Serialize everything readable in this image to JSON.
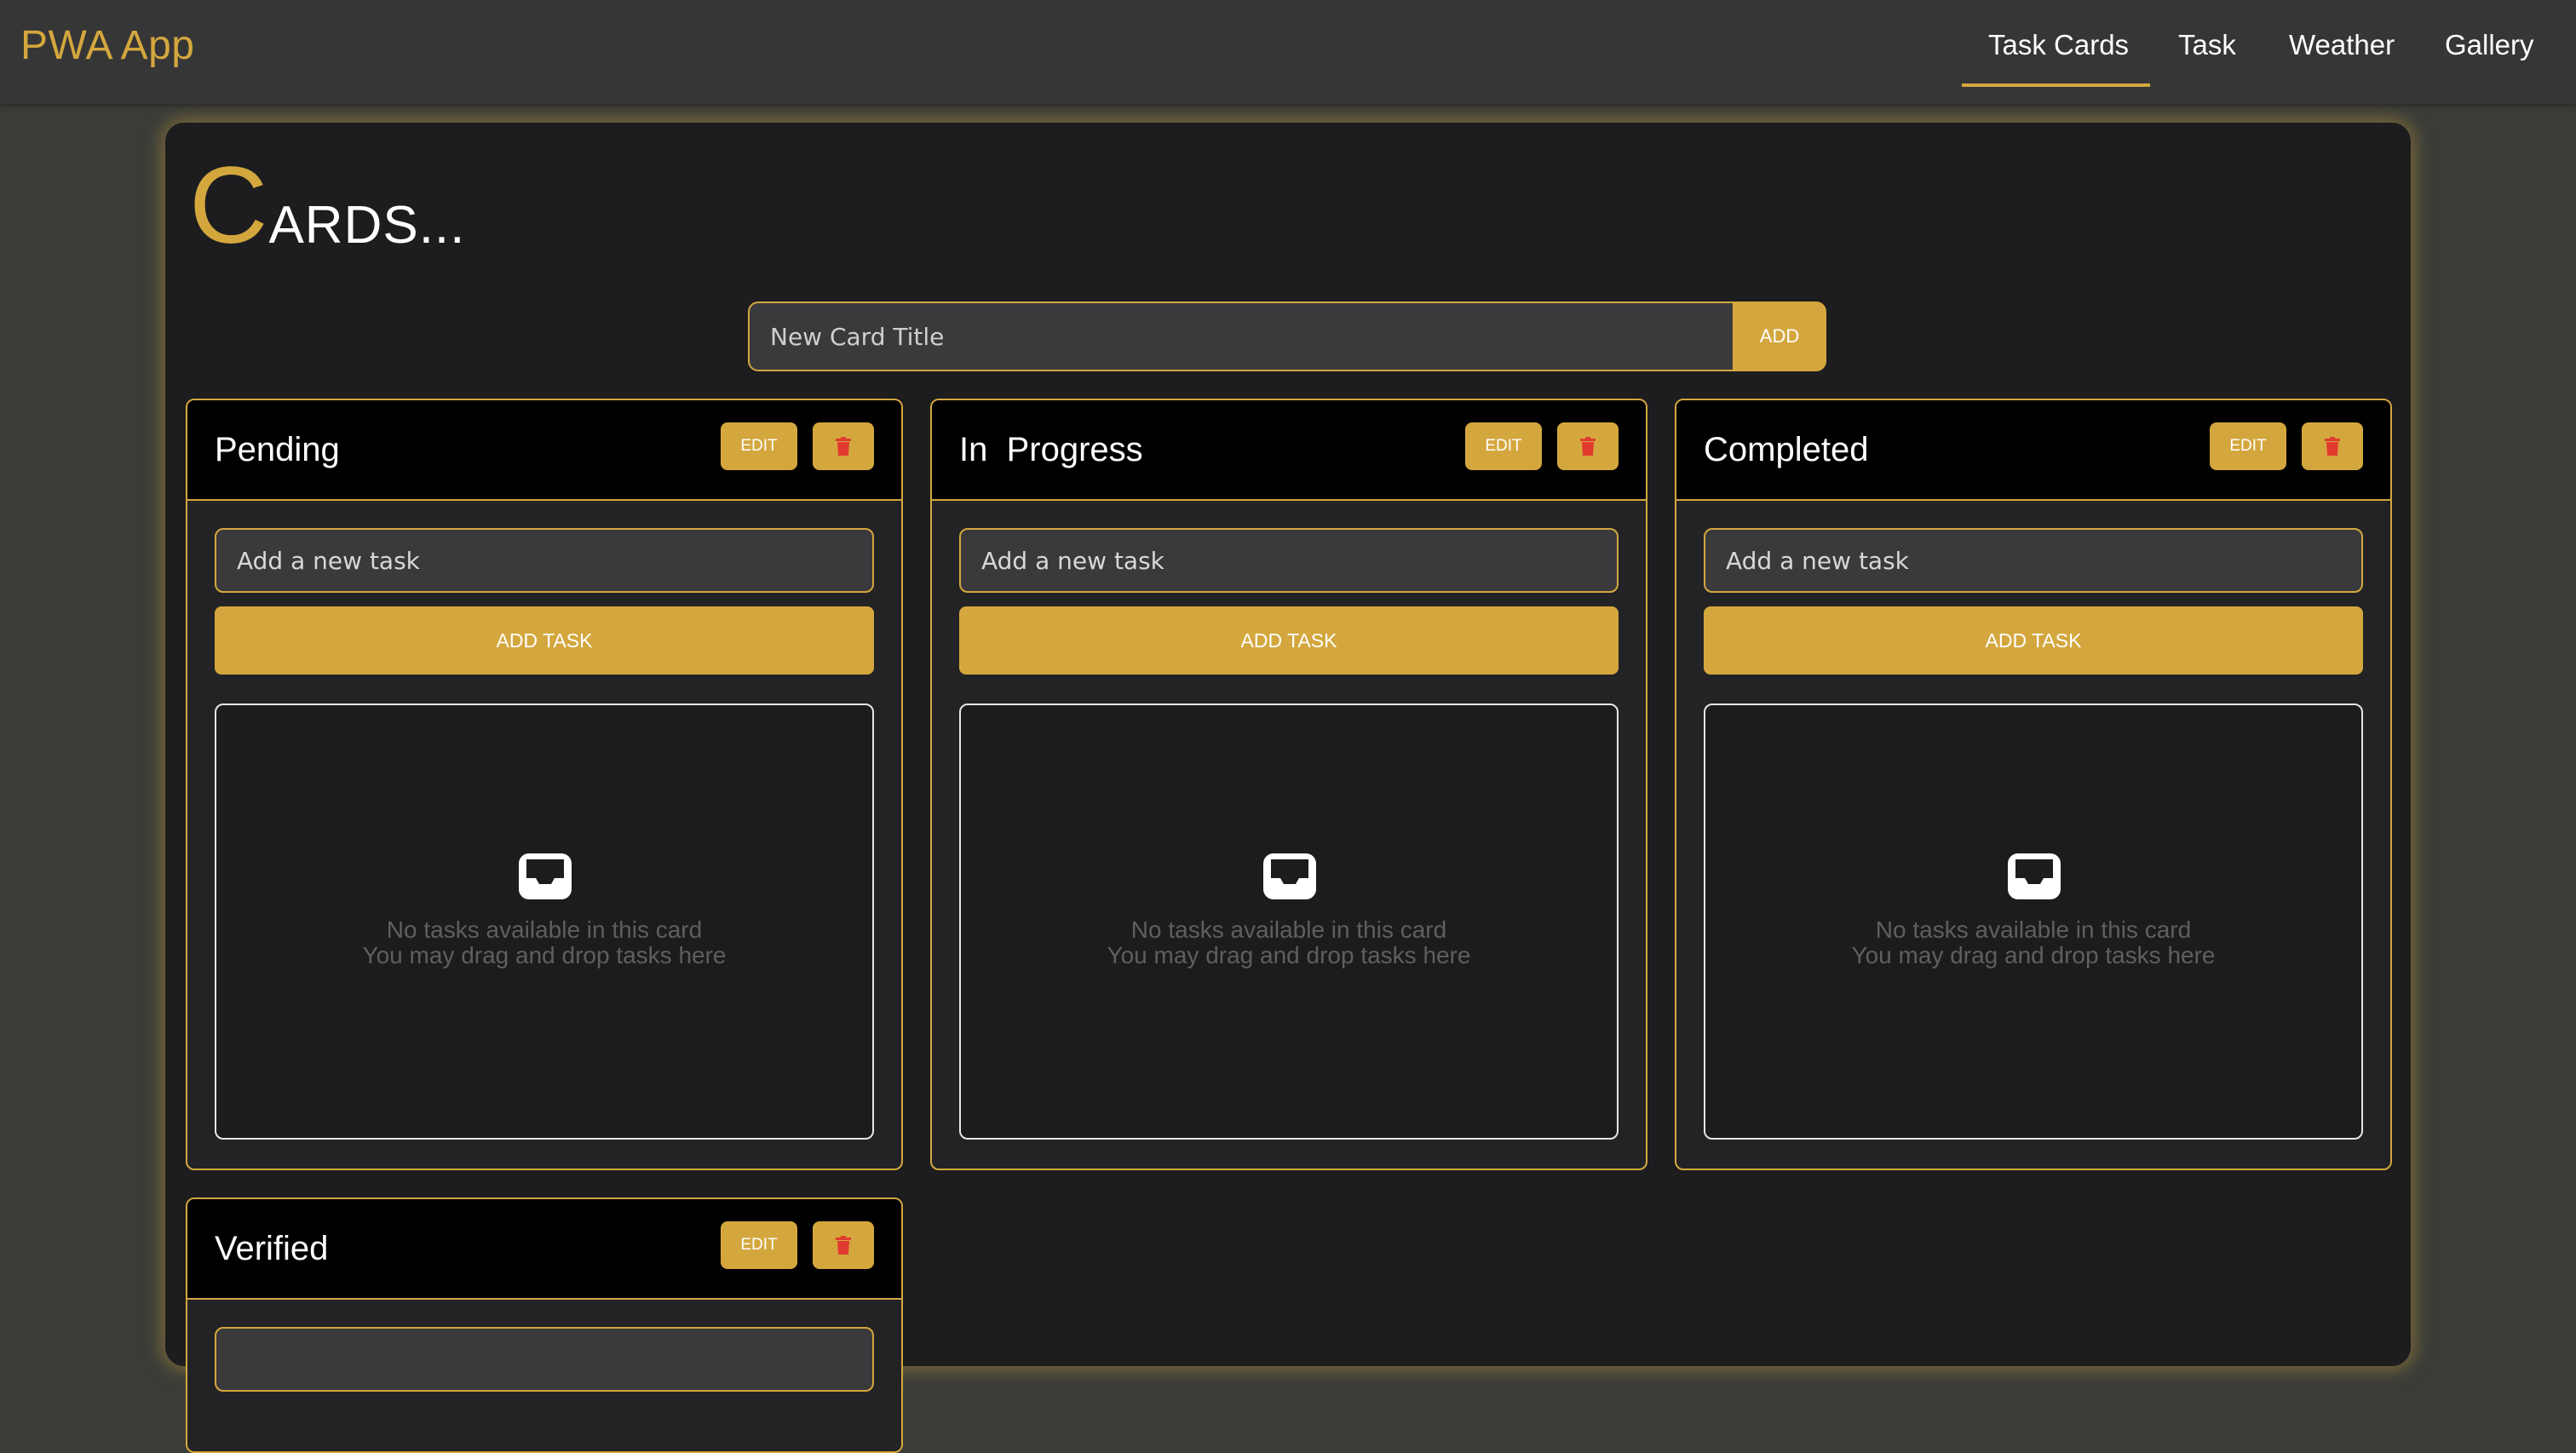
{
  "app": {
    "title": "PWA App"
  },
  "nav": {
    "items": [
      {
        "label": "Task Cards",
        "active": true
      },
      {
        "label": "Task",
        "active": false
      },
      {
        "label": "Weather",
        "active": false
      },
      {
        "label": "Gallery",
        "active": false
      }
    ]
  },
  "page": {
    "title_initial": "C",
    "title_rest": "ARDS..."
  },
  "new_card": {
    "placeholder": "New Card Title",
    "add_label": "ADD"
  },
  "cards": [
    {
      "title": "Pending",
      "edit_label": "EDIT",
      "task_placeholder": "Add a new task",
      "add_task_label": "ADD TASK",
      "empty_line_1": "No tasks available in this card",
      "empty_line_2": "You may drag and drop tasks here"
    },
    {
      "title": "In  Progress",
      "edit_label": "EDIT",
      "task_placeholder": "Add a new task",
      "add_task_label": "ADD TASK",
      "empty_line_1": "No tasks available in this card",
      "empty_line_2": "You may drag and drop tasks here"
    },
    {
      "title": "Completed",
      "edit_label": "EDIT",
      "task_placeholder": "Add a new task",
      "add_task_label": "ADD TASK",
      "empty_line_1": "No tasks available in this card",
      "empty_line_2": "You may drag and drop tasks here"
    },
    {
      "title": "Verified",
      "edit_label": "EDIT"
    }
  ],
  "icons": {
    "delete": "trash-icon",
    "empty_state": "inbox-icon"
  },
  "colors": {
    "accent": "#d4a73e",
    "delete_icon": "#e03b2e",
    "background": "#3a3c38",
    "panel": "#1d1d1f",
    "card_header": "#000000"
  }
}
